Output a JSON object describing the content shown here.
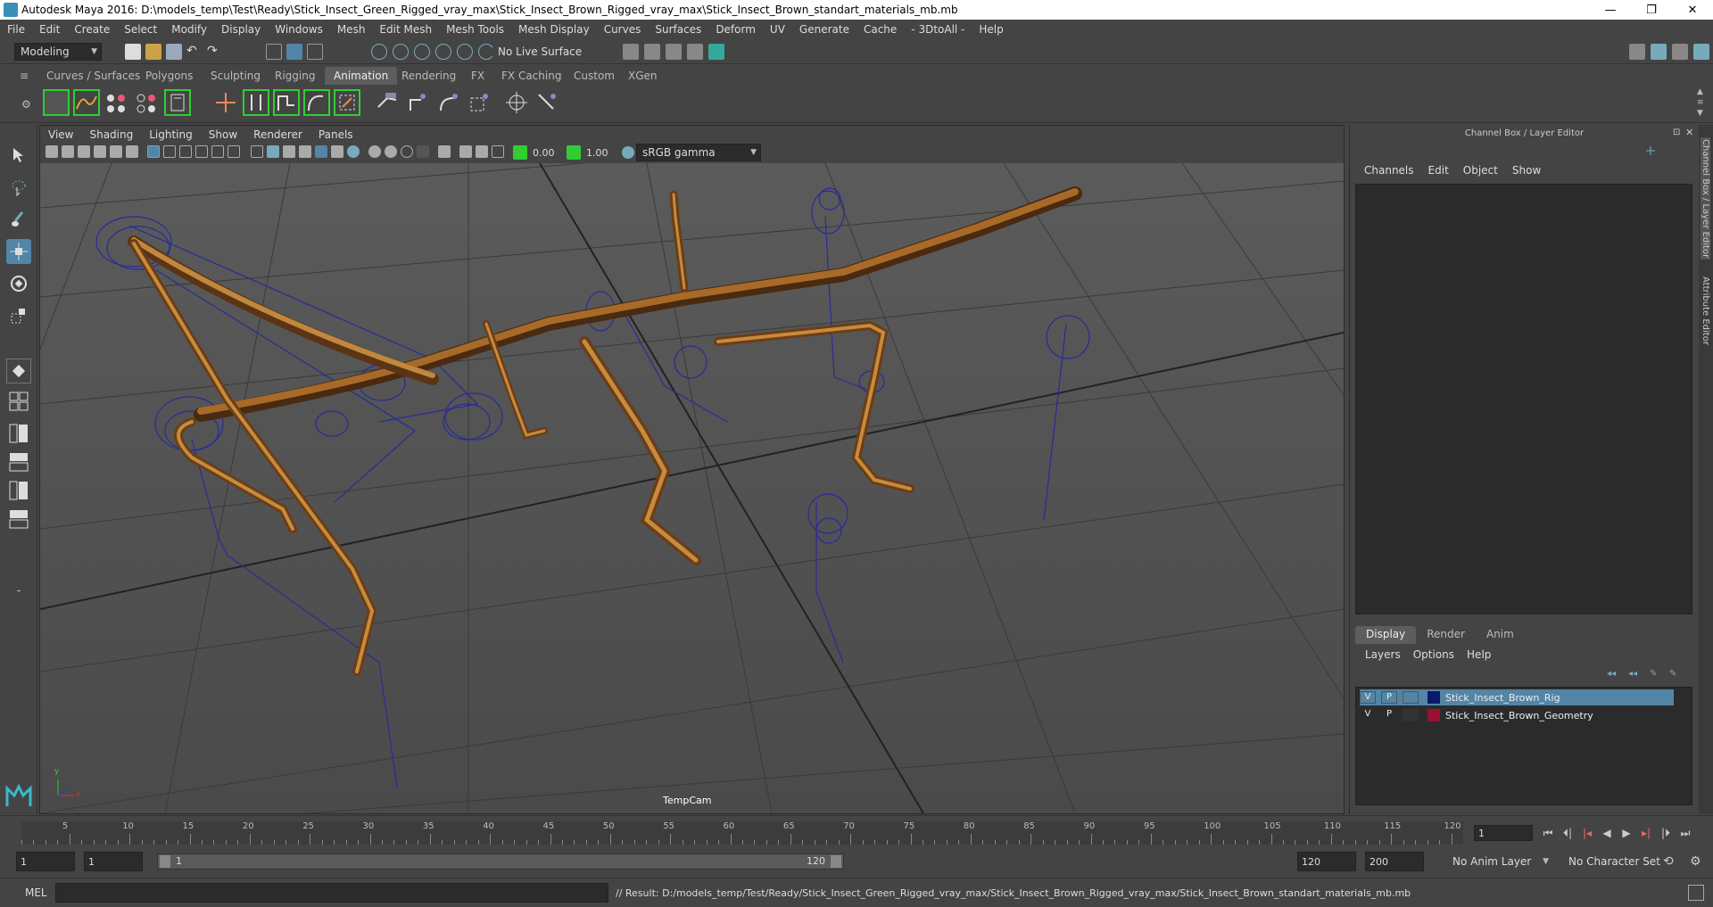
{
  "window": {
    "title": "Autodesk Maya 2016: D:\\models_temp\\Test\\Ready\\Stick_Insect_Green_Rigged_vray_max\\Stick_Insect_Brown_Rigged_vray_max\\Stick_Insect_Brown_standart_materials_mb.mb",
    "minimize": "—",
    "maximize": "❐",
    "close": "✕"
  },
  "menubar": [
    "File",
    "Edit",
    "Create",
    "Select",
    "Modify",
    "Display",
    "Windows",
    "Mesh",
    "Edit Mesh",
    "Mesh Tools",
    "Mesh Display",
    "Curves",
    "Surfaces",
    "Deform",
    "UV",
    "Generate",
    "Cache",
    "- 3DtoAll -",
    "Help"
  ],
  "statusline": {
    "mode": "Modeling",
    "live_surface": "No Live Surface"
  },
  "shelf_tabs": [
    "Curves / Surfaces",
    "Polygons",
    "Sculpting",
    "Rigging",
    "Animation",
    "Rendering",
    "FX",
    "FX Caching",
    "Custom",
    "XGen"
  ],
  "active_shelf": "Animation",
  "viewport": {
    "menu": [
      "View",
      "Shading",
      "Lighting",
      "Show",
      "Renderer",
      "Panels"
    ],
    "exposure": "0.00",
    "gamma": "1.00",
    "color_space": "sRGB gamma",
    "camera": "TempCam"
  },
  "channel_box": {
    "title": "Channel Box / Layer Editor",
    "menu": [
      "Channels",
      "Edit",
      "Object",
      "Show"
    ]
  },
  "layer_editor": {
    "tabs": [
      "Display",
      "Render",
      "Anim"
    ],
    "menu": [
      "Layers",
      "Options",
      "Help"
    ],
    "layers": [
      {
        "v": "V",
        "p": "P",
        "name": "Stick_Insect_Brown_Rig",
        "color": "#0a1a6a",
        "selected": true
      },
      {
        "v": "V",
        "p": "P",
        "name": "Stick_Insect_Brown_Geometry",
        "color": "#9a1030",
        "selected": false
      }
    ]
  },
  "side_tabs": [
    "Channel Box / Layer Editor",
    "Attribute Editor"
  ],
  "timeslider": {
    "ticks": [
      "5",
      "10",
      "15",
      "20",
      "25",
      "30",
      "35",
      "40",
      "45",
      "50",
      "55",
      "60",
      "65",
      "70",
      "75",
      "80",
      "85",
      "90",
      "95",
      "100",
      "105",
      "110",
      "115",
      "120"
    ],
    "start_label": "1",
    "current_frame": "1"
  },
  "range": {
    "start": "1",
    "playback_start": "1",
    "range_start_label": "1",
    "range_end_label": "120",
    "playback_end": "120",
    "end": "200",
    "anim_layer": "No Anim Layer",
    "character_set": "No Character Set"
  },
  "cmdline": {
    "label": "MEL",
    "result": "// Result: D:/models_temp/Test/Ready/Stick_Insect_Green_Rigged_vray_max/Stick_Insect_Brown_Rigged_vray_max/Stick_Insect_Brown_standart_materials_mb.mb"
  },
  "axis": {
    "x": "x",
    "y": "y"
  }
}
